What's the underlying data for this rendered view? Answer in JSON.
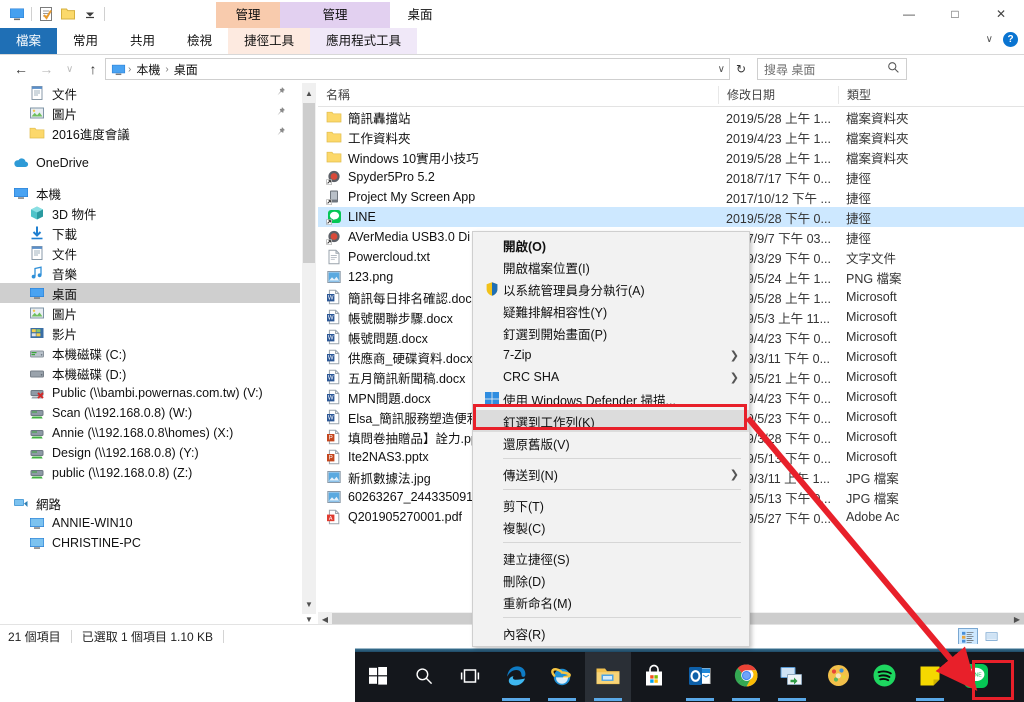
{
  "window": {
    "quick_access": [
      "desktop-icon",
      "properties-icon",
      "new-folder-icon",
      "customize-dropdown-icon"
    ],
    "controls": {
      "minimize": "—",
      "maximize": "□",
      "close": "✕"
    },
    "help_label": "?",
    "ribbon_collapse": "∨"
  },
  "ribbon": {
    "tabs": [
      {
        "label": "檔案",
        "active": true
      },
      {
        "label": "常用",
        "active": false
      },
      {
        "label": "共用",
        "active": false
      },
      {
        "label": "檢視",
        "active": false
      },
      {
        "label": "捷徑工具",
        "active": false,
        "ctx_color": "#f8cbad",
        "ctx_title": "管理"
      },
      {
        "label": "應用程式工具",
        "active": false,
        "ctx_color": "#e2d0f0",
        "ctx_title": "管理"
      }
    ],
    "window_title": "桌面"
  },
  "address": {
    "back": "←",
    "forward": "→",
    "recent": "∨",
    "up": "↑",
    "icon": "this-pc-icon",
    "crumbs": [
      "本機",
      "桌面"
    ],
    "separator": "›",
    "dropdown": "∨",
    "refresh": "↻"
  },
  "search": {
    "placeholder": "搜尋 桌面",
    "icon": "search-icon"
  },
  "nav_pane": {
    "items": [
      {
        "label": "文件",
        "icon": "documents-icon",
        "indent": 2,
        "pinned": true
      },
      {
        "label": "圖片",
        "icon": "pictures-icon",
        "indent": 2,
        "pinned": true
      },
      {
        "label": "2016進度會議",
        "icon": "folder-icon",
        "indent": 2,
        "pinned": true
      },
      {
        "gap": true
      },
      {
        "label": "OneDrive",
        "icon": "onedrive-icon",
        "indent": 1
      },
      {
        "gap": true
      },
      {
        "label": "本機",
        "icon": "this-pc-icon",
        "indent": 1
      },
      {
        "label": "3D 物件",
        "icon": "3dobjects-icon",
        "indent": 2
      },
      {
        "label": "下載",
        "icon": "downloads-icon",
        "indent": 2
      },
      {
        "label": "文件",
        "icon": "documents-icon",
        "indent": 2
      },
      {
        "label": "音樂",
        "icon": "music-icon",
        "indent": 2
      },
      {
        "label": "桌面",
        "icon": "desktop-icon",
        "indent": 2,
        "selected": true
      },
      {
        "label": "圖片",
        "icon": "pictures-icon",
        "indent": 2
      },
      {
        "label": "影片",
        "icon": "videos-icon",
        "indent": 2
      },
      {
        "label": "本機磁碟 (C:)",
        "icon": "localdisk-c-icon",
        "indent": 2
      },
      {
        "label": "本機磁碟 (D:)",
        "icon": "localdisk-d-icon",
        "indent": 2
      },
      {
        "label": "Public (\\\\bambi.powernas.com.tw) (V:)",
        "icon": "disconnected-drive-icon",
        "indent": 2
      },
      {
        "label": "Scan (\\\\192.168.0.8) (W:)",
        "icon": "network-drive-icon",
        "indent": 2
      },
      {
        "label": "Annie (\\\\192.168.0.8\\homes) (X:)",
        "icon": "network-drive-icon",
        "indent": 2
      },
      {
        "label": "Design (\\\\192.168.0.8) (Y:)",
        "icon": "network-drive-icon",
        "indent": 2
      },
      {
        "label": "public (\\\\192.168.0.8) (Z:)",
        "icon": "network-drive-icon",
        "indent": 2
      },
      {
        "gap": true
      },
      {
        "label": "網路",
        "icon": "network-icon",
        "indent": 1
      },
      {
        "label": "ANNIE-WIN10",
        "icon": "computer-icon",
        "indent": 2
      },
      {
        "label": "CHRISTINE-PC",
        "icon": "computer-icon",
        "indent": 2
      }
    ]
  },
  "file_list": {
    "columns": [
      "名稱",
      "修改日期",
      "類型"
    ],
    "rows": [
      {
        "name": "簡訊轟擋站",
        "icon": "folder-icon",
        "date": "2019/5/28 上午 1...",
        "type": "檔案資料夾"
      },
      {
        "name": "工作資料夾",
        "icon": "folder-icon",
        "date": "2019/4/23 上午 1...",
        "type": "檔案資料夾"
      },
      {
        "name": "Windows 10實用小技巧",
        "icon": "folder-icon",
        "date": "2019/5/28 上午 1...",
        "type": "檔案資料夾"
      },
      {
        "name": "Spyder5Pro 5.2",
        "icon": "shortcut-app-icon",
        "date": "2018/7/17 下午 0...",
        "type": "捷徑"
      },
      {
        "name": "Project My Screen App",
        "icon": "shortcut-app2-icon",
        "date": "2017/10/12 下午 ...",
        "type": "捷徑"
      },
      {
        "name": "LINE",
        "icon": "line-shortcut-icon",
        "date": "2019/5/28 下午 0...",
        "type": "捷徑",
        "selected": true
      },
      {
        "name": "AVerMedia USB3.0 Di",
        "icon": "shortcut-app-icon",
        "date": "2017/9/7 下午 03...",
        "type": "捷徑"
      },
      {
        "name": "Powercloud.txt",
        "icon": "text-file-icon",
        "date": "2019/3/29 下午 0...",
        "type": "文字文件"
      },
      {
        "name": "123.png",
        "icon": "image-file-icon",
        "date": "2019/5/24 上午 1...",
        "type": "PNG 檔案"
      },
      {
        "name": "簡訊每日排名確認.docx",
        "icon": "word-file-icon",
        "date": "2019/5/28 上午 1...",
        "type": "Microsoft"
      },
      {
        "name": "帳號關聯步驟.docx",
        "icon": "word-file-icon",
        "date": "2019/5/3 上午 11...",
        "type": "Microsoft"
      },
      {
        "name": "帳號問題.docx",
        "icon": "word-file-icon",
        "date": "2019/4/23 下午 0...",
        "type": "Microsoft"
      },
      {
        "name": "供應商_硬碟資料.docx",
        "icon": "word-file-icon",
        "date": "2019/3/11 下午 0...",
        "type": "Microsoft"
      },
      {
        "name": "五月簡訊新聞稿.docx",
        "icon": "word-file-icon",
        "date": "2019/5/21 上午 0...",
        "type": "Microsoft"
      },
      {
        "name": "MPN問題.docx",
        "icon": "word-file-icon",
        "date": "2019/4/23 下午 0...",
        "type": "Microsoft"
      },
      {
        "name": "Elsa_簡訊服務塑造便利",
        "icon": "word-file-icon",
        "date": "2019/5/23 下午 0...",
        "type": "Microsoft"
      },
      {
        "name": "填問卷抽贈品】詮力.pp",
        "icon": "ppt-file-icon",
        "date": "2019/3/28 下午 0...",
        "type": "Microsoft"
      },
      {
        "name": "Ite2NAS3.pptx",
        "icon": "ppt-file-icon",
        "date": "2019/5/13 下午 0...",
        "type": "Microsoft"
      },
      {
        "name": "新抓數據法.jpg",
        "icon": "image-file-icon",
        "date": "2019/3/11 上午 1...",
        "type": "JPG 檔案"
      },
      {
        "name": "60263267_244335091",
        "icon": "image-file-icon",
        "date": "2019/5/13 下午 0...",
        "type": "JPG 檔案"
      },
      {
        "name": "Q201905270001.pdf",
        "icon": "pdf-file-icon",
        "date": "2019/5/27 下午 0...",
        "type": "Adobe Ac"
      }
    ]
  },
  "context_menu": {
    "items": [
      {
        "label": "開啟(O)",
        "bold": true
      },
      {
        "label": "開啟檔案位置(I)"
      },
      {
        "label": "以系統管理員身分執行(A)",
        "icon": "uac-shield-icon"
      },
      {
        "label": "疑難排解相容性(Y)"
      },
      {
        "label": "釘選到開始畫面(P)"
      },
      {
        "label": "7-Zip",
        "submenu": true
      },
      {
        "label": "CRC SHA",
        "submenu": true
      },
      {
        "label": "使用 Windows Defender 掃描...",
        "icon": "defender-icon"
      },
      {
        "label": "釘選到工作列(K)",
        "highlighted": true
      },
      {
        "label": "還原舊版(V)"
      },
      {
        "separator": true
      },
      {
        "label": "傳送到(N)",
        "submenu": true
      },
      {
        "separator": true
      },
      {
        "label": "剪下(T)"
      },
      {
        "label": "複製(C)"
      },
      {
        "separator": true
      },
      {
        "label": "建立捷徑(S)"
      },
      {
        "label": "刪除(D)"
      },
      {
        "label": "重新命名(M)"
      },
      {
        "separator": true
      },
      {
        "label": "內容(R)"
      }
    ]
  },
  "status_bar": {
    "item_count": "21 個項目",
    "selection": "已選取 1 個項目  1.10 KB",
    "view_buttons": [
      "details-view-icon",
      "large-icons-view-icon"
    ]
  },
  "taskbar": {
    "items": [
      {
        "name": "start-button",
        "icon": "windows-logo-icon"
      },
      {
        "name": "search-button",
        "icon": "search-icon"
      },
      {
        "name": "task-view-button",
        "icon": "task-view-icon"
      },
      {
        "name": "edge-button",
        "icon": "edge-icon",
        "running": true
      },
      {
        "name": "internet-explorer-button",
        "icon": "ie-icon",
        "running": true
      },
      {
        "name": "file-explorer-button",
        "icon": "file-explorer-icon",
        "running": true,
        "active": true
      },
      {
        "name": "microsoft-store-button",
        "icon": "store-icon"
      },
      {
        "name": "outlook-button",
        "icon": "outlook-icon",
        "running": true
      },
      {
        "name": "chrome-button",
        "icon": "chrome-icon",
        "running": true
      },
      {
        "name": "remote-desktop-button",
        "icon": "remote-desktop-icon",
        "running": true
      },
      {
        "name": "paint-button",
        "icon": "paint-icon"
      },
      {
        "name": "spotify-button",
        "icon": "spotify-icon"
      },
      {
        "name": "sticky-notes-button",
        "icon": "sticky-notes-icon",
        "running": true
      },
      {
        "name": "line-button",
        "icon": "line-icon",
        "highlighted": true
      }
    ]
  },
  "annotations": {
    "highlight_color": "#e8202a",
    "arrow": "red-arrow-annotation",
    "boxes": [
      "pin-to-taskbar-menu-item",
      "line-taskbar-icon"
    ]
  }
}
